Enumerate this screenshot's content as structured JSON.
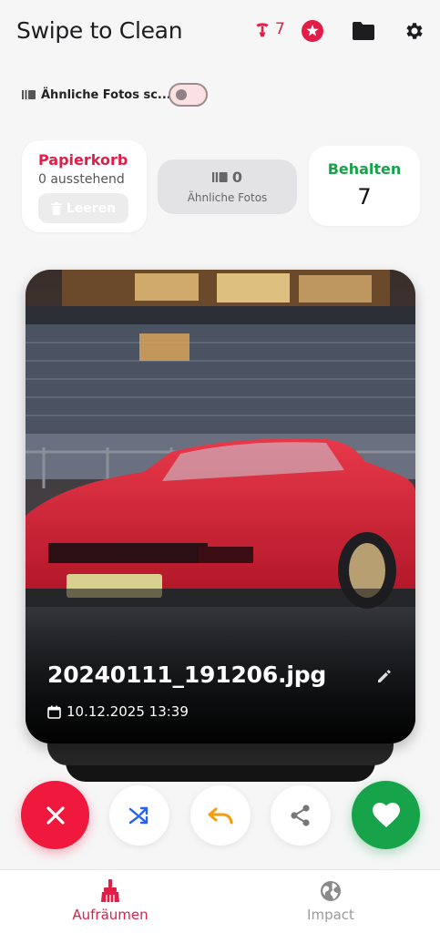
{
  "header": {
    "title": "Swipe to Clean",
    "streak_count": "7",
    "icons": [
      "broom-streak-icon",
      "star-badge-icon",
      "folder-icon",
      "gear-icon"
    ]
  },
  "similar_toggle": {
    "label": "Ähnliche Fotos sc...",
    "enabled": false
  },
  "stats": {
    "trash": {
      "title": "Papierkorb",
      "pending": "0 ausstehend",
      "empty_label": "Leeren"
    },
    "similar": {
      "count": "0",
      "label": "Ähnliche Fotos"
    },
    "kept": {
      "title": "Behalten",
      "count": "7"
    }
  },
  "photo": {
    "filename": "20240111_191206.jpg",
    "date": "10.12.2025 13:39"
  },
  "actions": [
    "delete",
    "shuffle",
    "undo",
    "share",
    "keep"
  ],
  "bottom_nav": {
    "items": [
      {
        "label": "Aufräumen",
        "icon": "broom-icon",
        "active": true
      },
      {
        "label": "Impact",
        "icon": "globe-icon",
        "active": false
      }
    ]
  },
  "colors": {
    "accent_red": "#e11d48",
    "delete_red": "#f0183c",
    "keep_green": "#16a34a",
    "undo_orange": "#f59e0b",
    "shuffle_blue": "#2563eb"
  }
}
